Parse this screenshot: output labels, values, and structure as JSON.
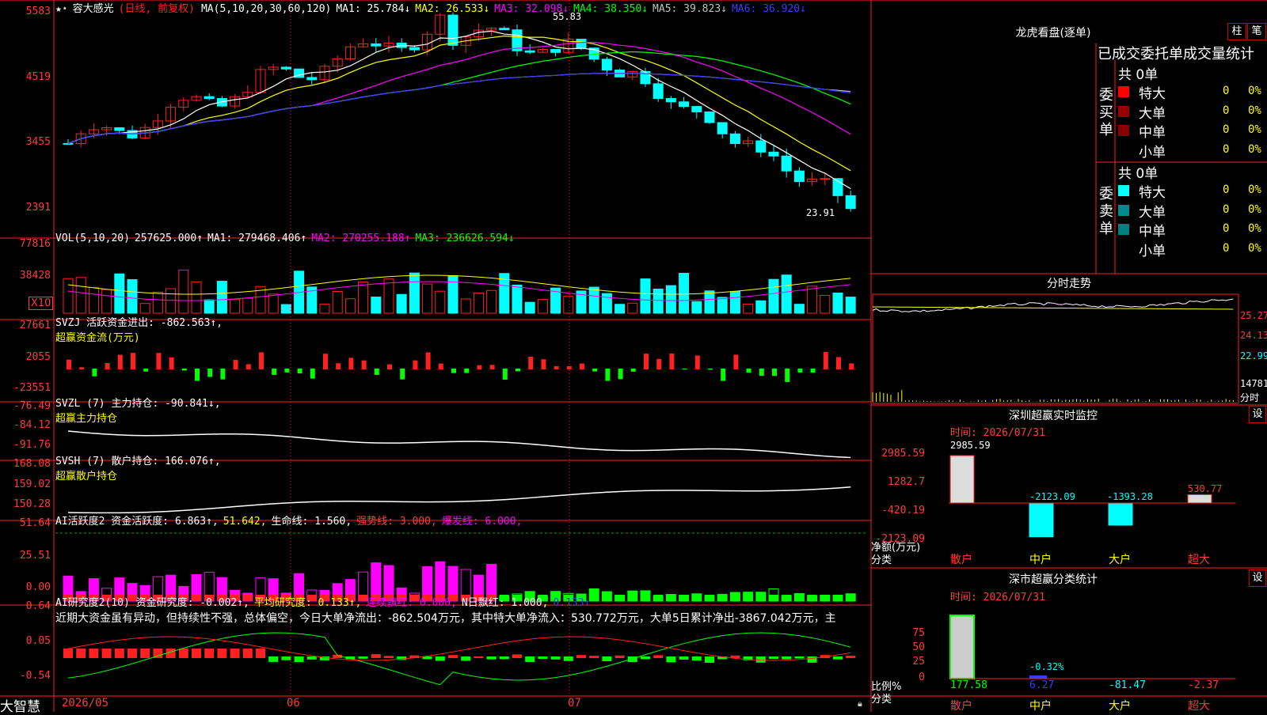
{
  "app": {
    "name": "大智慧"
  },
  "stock": {
    "name": "容大感光",
    "period": "(日线, 前复权)"
  },
  "price_panel": {
    "ma_def": "MA(5,10,20,30,60,120)",
    "ma": [
      {
        "label": "MA1: 25.784↓",
        "color": "#ffffff"
      },
      {
        "label": "MA2: 26.533↓",
        "color": "#ffff00"
      },
      {
        "label": "MA3: 32.098↓",
        "color": "#ff00ff"
      },
      {
        "label": "MA4: 38.350↓",
        "color": "#00ff00"
      },
      {
        "label": "MA5: 39.823↓",
        "color": "#c0c0c0"
      },
      {
        "label": "MA6: 36.920↓",
        "color": "#3b3bff"
      }
    ],
    "y_ticks": [
      "5583",
      "4519",
      "3455",
      "2391"
    ],
    "high_label": "55.83",
    "low_label": "23.91"
  },
  "vol_panel": {
    "title": "VOL(5,10,20)",
    "value": "257625.000↑",
    "ma": [
      {
        "label": "MA1: 279468.406↑",
        "color": "#ffffff"
      },
      {
        "label": "MA2: 270255.188↑",
        "color": "#ff00ff"
      },
      {
        "label": "MA3: 236626.594↓",
        "color": "#00ff00"
      }
    ],
    "y_ticks": [
      "77816",
      "38428"
    ],
    "unit": "X10"
  },
  "svzj_panel": {
    "title": "SVZJ  活跃资金进出: -862.563↑,",
    "subtitle": "超赢资金流(万元)",
    "y_ticks": [
      "27661",
      "2055",
      "-23551"
    ]
  },
  "svzl_panel": {
    "title": "SVZL (7) 主力持仓: -90.841↓,",
    "subtitle": "超赢主力持仓",
    "y_ticks": [
      "-76.49",
      "-84.12",
      "-91.76"
    ]
  },
  "svsh_panel": {
    "title": "SVSH (7) 散户持仓: 166.076↑,",
    "subtitle": "超赢散户持仓",
    "y_ticks": [
      "168.08",
      "159.02",
      "150.28"
    ]
  },
  "ai_active_panel": {
    "title": "AI活跃度2 资金活跃度: 6.863↑,",
    "v1": "51.642,",
    "v2": "生命线: 1.560,",
    "v3": "强势线: 3.000,",
    "v4": "爆发线: 6.000,",
    "y_ticks": [
      "51.64",
      "25.51",
      "0.00"
    ]
  },
  "ai_research_panel": {
    "title": "AI研究度2(10) 资金研究度: -0.002↑,",
    "v1": "平均研究度: 0.133↑,",
    "v2": "连续飘红: 0.000,",
    "v3": "N日飘红: 1.000,",
    "v4": "0.133↑",
    "note": "近期大资金虽有异动，但持续性不强，总体偏空，今日大单净流出：-862.504万元，其中特大单净流入：530.772万元，大单5日累计净出-3867.042万元，主",
    "y_ticks": [
      "0.64",
      "0.05",
      "-0.54"
    ]
  },
  "x_axis": {
    "labels": [
      "2026/05",
      "06",
      "07"
    ]
  },
  "dragon_tiger": {
    "title": "龙虎看盘(逐单)",
    "btn_bar": "柱",
    "btn_pen": "笔",
    "subtitle": "已成交委托单成交量统计",
    "buy": {
      "side_label": "委买单",
      "total": "共 0单",
      "rows": [
        {
          "label": "特大",
          "count": "0",
          "pct": "0%",
          "color": "#ff0000"
        },
        {
          "label": "大单",
          "count": "0",
          "pct": "0%",
          "color": "#990000"
        },
        {
          "label": "中单",
          "count": "0",
          "pct": "0%",
          "color": "#880000"
        },
        {
          "label": "小单",
          "count": "0",
          "pct": "0%",
          "color": ""
        }
      ]
    },
    "sell": {
      "side_label": "委卖单",
      "total": "共 0单",
      "rows": [
        {
          "label": "特大",
          "count": "0",
          "pct": "0%",
          "color": "#00ffff"
        },
        {
          "label": "大单",
          "count": "0",
          "pct": "0%",
          "color": "#008b8b"
        },
        {
          "label": "中单",
          "count": "0",
          "pct": "0%",
          "color": "#008080"
        },
        {
          "label": "小单",
          "count": "0",
          "pct": "0%",
          "color": ""
        }
      ]
    }
  },
  "intraday": {
    "title": "分时走势",
    "y_right": [
      "25.27",
      "24.13",
      "22.99",
      "14781",
      "分时"
    ]
  },
  "sz_monitor": {
    "title": "深圳超赢实时监控",
    "settings": "设",
    "time": "时间: 2026/07/31",
    "y_ticks": [
      "2985.59",
      "1282.7",
      "-420.19",
      "-2123.09"
    ],
    "y_label": "净额(万元)",
    "x_label": "分类",
    "categories": [
      "散户",
      "中户",
      "大户",
      "超大"
    ],
    "values": [
      2985.59,
      -2123.09,
      -1393.28,
      530.77
    ],
    "value_labels": [
      "2985.59",
      "-2123.09",
      "-1393.28",
      "530.77"
    ]
  },
  "sz_class": {
    "title": "深市超赢分类统计",
    "settings": "设",
    "time": "时间: 2026/07/31",
    "y_ticks": [
      "75",
      "50",
      "25",
      "0"
    ],
    "y_label": "比例%",
    "x_label": "分类",
    "categories": [
      "散户",
      "中户",
      "大户",
      "超大"
    ],
    "bottom_values": [
      "177.58",
      "6.27",
      "-81.47",
      "-2.37"
    ],
    "bar_label": "-0.32%"
  }
}
